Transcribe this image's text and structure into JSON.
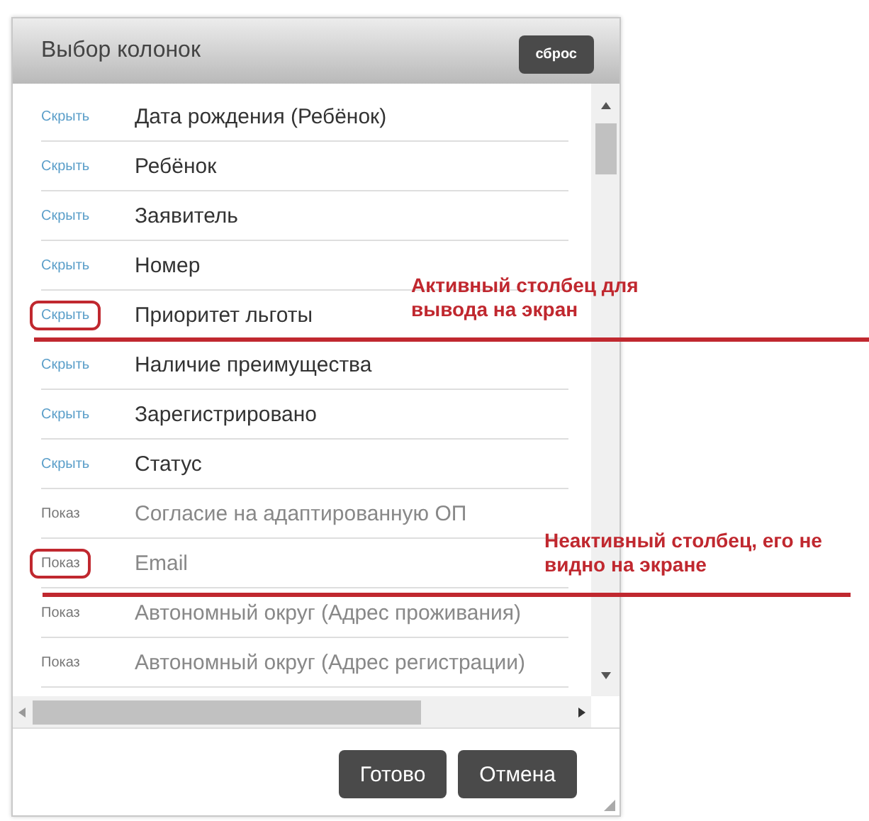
{
  "dialog": {
    "title": "Выбор колонок",
    "reset_button": "сброс",
    "columns": [
      {
        "toggle": "Скрыть",
        "label": "Дата рождения (Ребёнок)",
        "visible": true,
        "highlighted": false
      },
      {
        "toggle": "Скрыть",
        "label": "Ребёнок",
        "visible": true,
        "highlighted": false
      },
      {
        "toggle": "Скрыть",
        "label": "Заявитель",
        "visible": true,
        "highlighted": false
      },
      {
        "toggle": "Скрыть",
        "label": "Номер",
        "visible": true,
        "highlighted": false
      },
      {
        "toggle": "Скрыть",
        "label": "Приоритет льготы",
        "visible": true,
        "highlighted": true
      },
      {
        "toggle": "Скрыть",
        "label": "Наличие преимущества",
        "visible": true,
        "highlighted": false
      },
      {
        "toggle": "Скрыть",
        "label": "Зарегистрировано",
        "visible": true,
        "highlighted": false
      },
      {
        "toggle": "Скрыть",
        "label": "Статус",
        "visible": true,
        "highlighted": false
      },
      {
        "toggle": "Показ",
        "label": "Согласие на адаптированную ОП",
        "visible": false,
        "highlighted": false
      },
      {
        "toggle": "Показ",
        "label": "Email",
        "visible": false,
        "highlighted": true
      },
      {
        "toggle": "Показ",
        "label": "Автономный округ (Адрес проживания)",
        "visible": false,
        "highlighted": false
      },
      {
        "toggle": "Показ",
        "label": "Автономный округ (Адрес регистрации)",
        "visible": false,
        "highlighted": false
      }
    ],
    "buttons": [
      "Готово",
      "Отмена"
    ]
  },
  "annotations": [
    {
      "text": "Активный столбец для вывода на экран"
    },
    {
      "text": "Неактивный столбец, его не видно на экране"
    }
  ]
}
